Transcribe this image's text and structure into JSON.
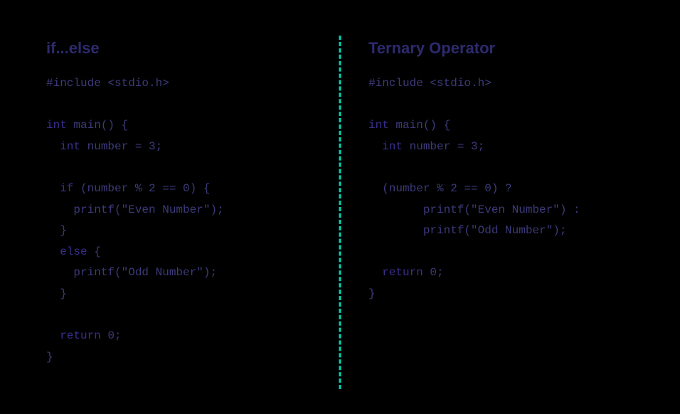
{
  "left": {
    "title": "if...else",
    "lines": {
      "l1": "#include <stdio.h>",
      "l2": "",
      "l3a": "int",
      "l3b": " main() {",
      "l4a": "  int",
      "l4b": " number = 3;",
      "l5": "",
      "l6a": "  if",
      "l6b": " (number % 2 == 0) {",
      "l7": "    printf(\"Even Number\");",
      "l8": "  }",
      "l9a": "  else",
      "l9b": " {",
      "l10": "    printf(\"Odd Number\");",
      "l11": "  }",
      "l12": "",
      "l13a": "  return",
      "l13b": " 0;",
      "l14": "}"
    }
  },
  "right": {
    "title": "Ternary Operator",
    "lines": {
      "l1": "#include <stdio.h>",
      "l2": "",
      "l3a": "int",
      "l3b": " main() {",
      "l4a": "  int",
      "l4b": " number = 3;",
      "l5": "",
      "l6": "  (number % 2 == 0) ?",
      "l7": "        printf(\"Even Number\") :",
      "l8": "        printf(\"Odd Number\");",
      "l9": "",
      "l10a": "  return",
      "l10b": " 0;",
      "l11": "}"
    }
  }
}
